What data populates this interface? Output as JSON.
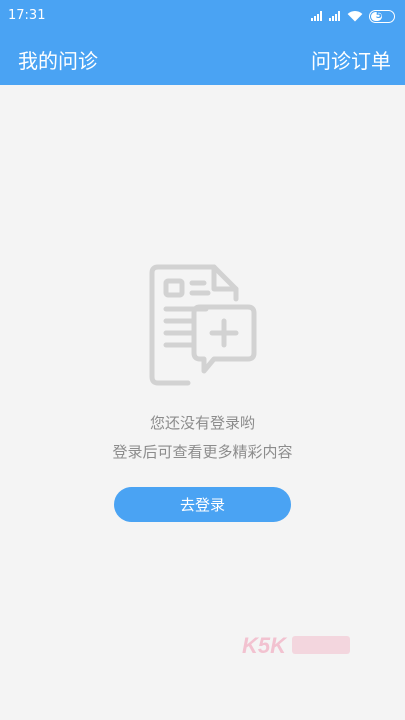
{
  "status_bar": {
    "time": "17:31",
    "battery": "56",
    "battery_level": 0.56,
    "icons": [
      "signal-icon",
      "signal-icon",
      "wifi-icon",
      "battery-icon"
    ]
  },
  "header": {
    "title": "我的问诊",
    "orders_label": "问诊订单"
  },
  "empty_state": {
    "icon": "document-plus-icon",
    "line1": "您还没有登录哟",
    "line2": "登录后可查看更多精彩内容",
    "login_button": "去登录"
  },
  "watermark": {
    "text": "K5K"
  },
  "colors": {
    "primary": "#4aa3f3",
    "background": "#f4f4f4",
    "muted_text": "#8c8c8c",
    "illustration": "#d2d2d2"
  }
}
